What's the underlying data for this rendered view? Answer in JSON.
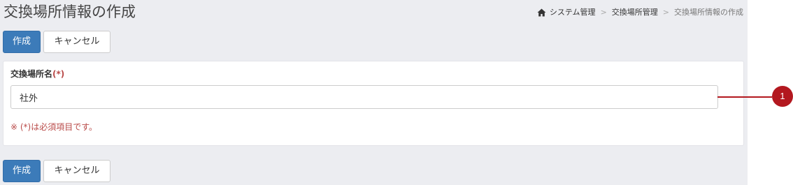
{
  "header": {
    "title": "交換場所情報の作成"
  },
  "breadcrumb": {
    "home_icon": "home-icon",
    "items": [
      "システム管理",
      "交換場所管理",
      "交換場所情報の作成"
    ],
    "separator": ">"
  },
  "actions": {
    "create_label": "作成",
    "cancel_label": "キャンセル"
  },
  "form": {
    "field_label": "交換場所名",
    "required_mark": "(*)",
    "field_value": "社外",
    "required_note": "※ (*)は必須項目です。"
  },
  "callout": {
    "number": "1"
  },
  "colors": {
    "primary": "#3c7bb9",
    "required": "#b94a48",
    "callout": "#b3181f",
    "background": "#ecedf1"
  }
}
